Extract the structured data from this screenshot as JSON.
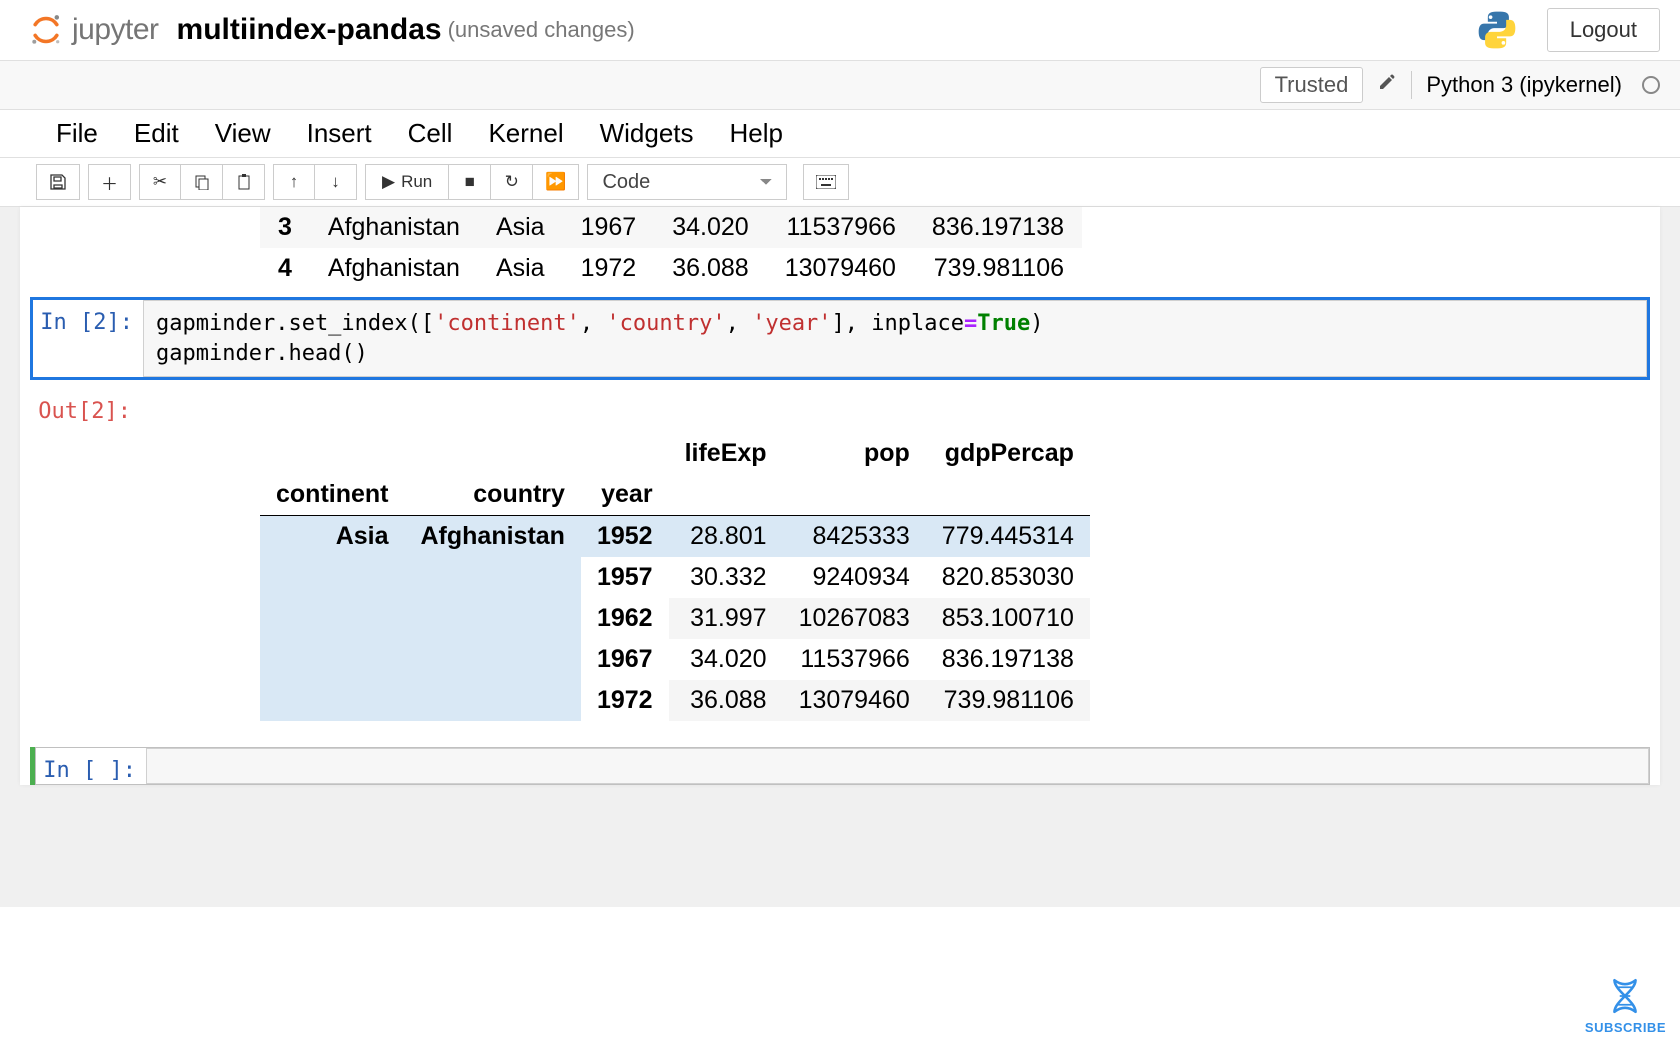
{
  "header": {
    "logo_text": "jupyter",
    "notebook_name": "multiindex-pandas",
    "unsaved_label": "(unsaved changes)",
    "logout_label": "Logout"
  },
  "subheader": {
    "trusted_label": "Trusted",
    "kernel_label": "Python 3 (ipykernel)"
  },
  "menubar": {
    "items": [
      "File",
      "Edit",
      "View",
      "Insert",
      "Cell",
      "Kernel",
      "Widgets",
      "Help"
    ]
  },
  "toolbar": {
    "run_label": "Run",
    "cell_type": "Code"
  },
  "prev_output": {
    "rows": [
      {
        "idx": "3",
        "country": "Afghanistan",
        "continent": "Asia",
        "year": "1967",
        "lifeExp": "34.020",
        "pop": "11537966",
        "gdp": "836.197138"
      },
      {
        "idx": "4",
        "country": "Afghanistan",
        "continent": "Asia",
        "year": "1972",
        "lifeExp": "36.088",
        "pop": "13079460",
        "gdp": "739.981106"
      }
    ]
  },
  "cell_in2": {
    "prompt": "In [2]:",
    "code_line1_pre": "gapminder.set_index([",
    "code_line1_s1": "'continent'",
    "code_line1_c1": ", ",
    "code_line1_s2": "'country'",
    "code_line1_c2": ", ",
    "code_line1_s3": "'year'",
    "code_line1_post": "], inplace",
    "code_line1_eq": "=",
    "code_line1_true": "True",
    "code_line1_close": ")",
    "code_line2": "gapminder.head()"
  },
  "cell_out2": {
    "prompt": "Out[2]:",
    "columns": [
      "lifeExp",
      "pop",
      "gdpPercap"
    ],
    "index_names": [
      "continent",
      "country",
      "year"
    ],
    "continent0": "Asia",
    "country0": "Afghanistan",
    "rows": [
      {
        "year": "1952",
        "lifeExp": "28.801",
        "pop": "8425333",
        "gdp": "779.445314"
      },
      {
        "year": "1957",
        "lifeExp": "30.332",
        "pop": "9240934",
        "gdp": "820.853030"
      },
      {
        "year": "1962",
        "lifeExp": "31.997",
        "pop": "10267083",
        "gdp": "853.100710"
      },
      {
        "year": "1967",
        "lifeExp": "34.020",
        "pop": "11537966",
        "gdp": "836.197138"
      },
      {
        "year": "1972",
        "lifeExp": "36.088",
        "pop": "13079460",
        "gdp": "739.981106"
      }
    ]
  },
  "cell_empty": {
    "prompt": "In [ ]:"
  },
  "subscribe_label": "SUBSCRIBE"
}
